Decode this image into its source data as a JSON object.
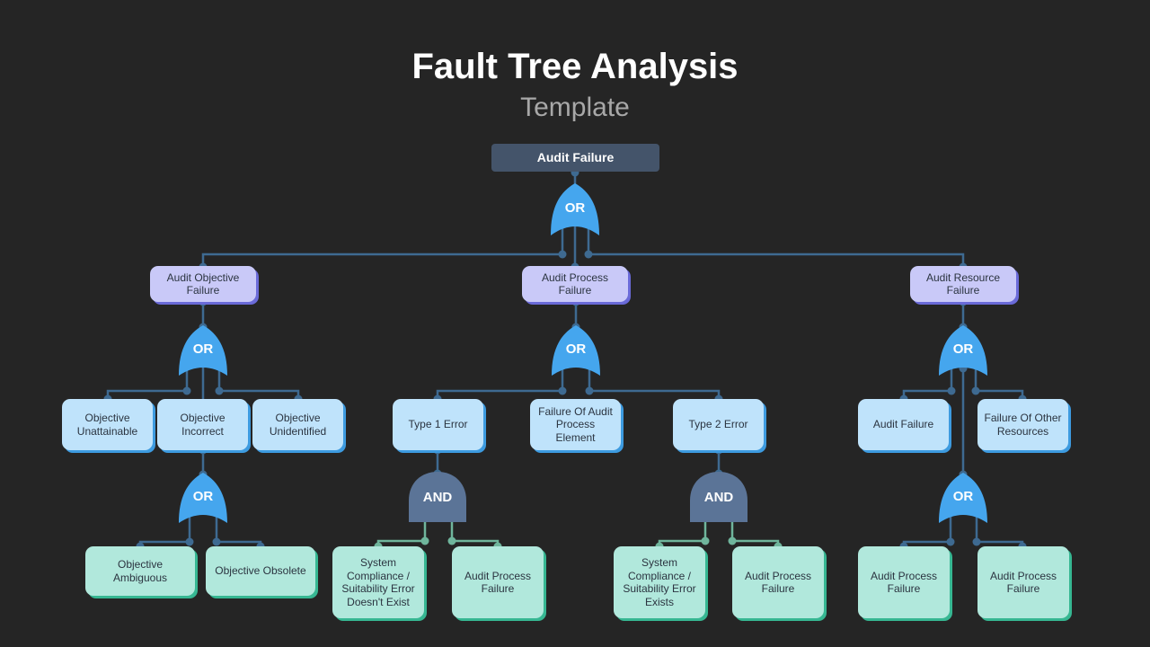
{
  "header": {
    "title": "Fault Tree Analysis",
    "subtitle": "Template"
  },
  "colors": {
    "background": "#252525",
    "root": "#44546a",
    "level1": "#c9c9f8",
    "level2": "#bfe3fb",
    "level3": "#b1e8dc",
    "or_gate": "#45a6ee",
    "and_gate": "#5b7497",
    "connector": "#3e6a91",
    "and_connector": "#6fb59c"
  },
  "tree": {
    "root": "Audit Failure",
    "root_gate": "OR",
    "branches": [
      {
        "label": "Audit Objective Failure",
        "gate": "OR",
        "children": [
          {
            "label": "Objective Unattainable"
          },
          {
            "label": "Objective Incorrect",
            "gate": "OR",
            "children": [
              {
                "label": "Objective Ambiguous"
              },
              {
                "label": "Objective Obsolete"
              }
            ]
          },
          {
            "label": "Objective Unidentified"
          }
        ]
      },
      {
        "label": "Audit Process Failure",
        "gate": "OR",
        "children": [
          {
            "label": "Type 1 Error",
            "gate": "AND",
            "children": [
              {
                "label": "System Compliance / Suitability Error Doesn't Exist"
              },
              {
                "label": "Audit Process Failure"
              }
            ]
          },
          {
            "label": "Failure Of Audit Process Element"
          },
          {
            "label": "Type 2 Error",
            "gate": "AND",
            "children": [
              {
                "label": "System Compliance / Suitability Error Exists"
              },
              {
                "label": "Audit Process Failure"
              }
            ]
          }
        ]
      },
      {
        "label": "Audit Resource Failure",
        "gate": "OR",
        "children": [
          {
            "label": "Audit Failure"
          },
          {
            "label": "Failure Of Other Resources"
          }
        ],
        "sub_gate": "OR",
        "sub_children": [
          {
            "label": "Audit Process Failure"
          },
          {
            "label": "Audit Process Failure"
          }
        ]
      }
    ]
  }
}
